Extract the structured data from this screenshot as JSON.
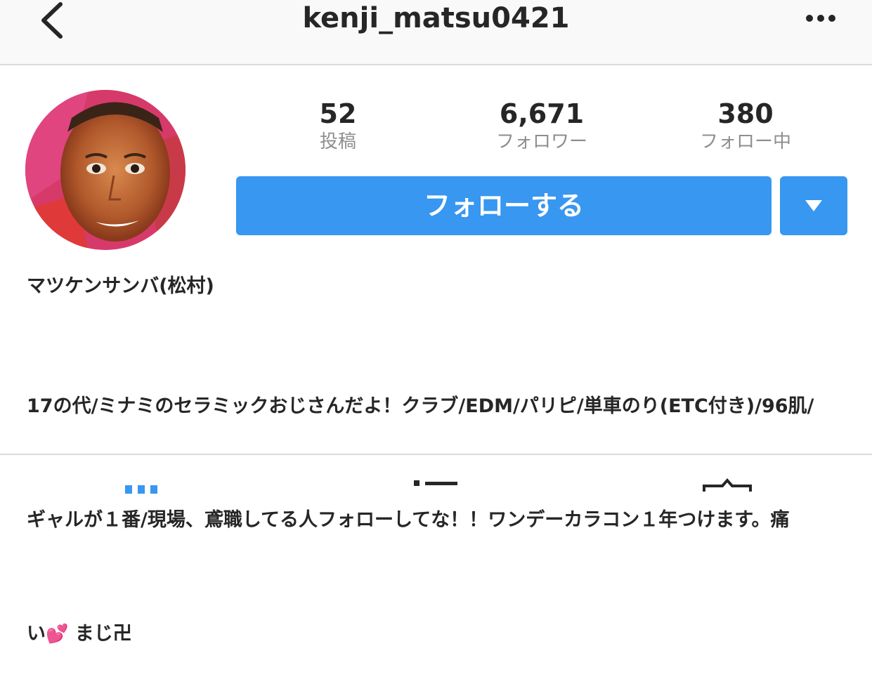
{
  "header": {
    "username": "kenji_matsu0421",
    "back_icon": "chevron-left-icon",
    "more_icon": "more-horizontal-icon"
  },
  "profile": {
    "avatar_icon": "profile-avatar"
  },
  "stats": [
    {
      "value": "52",
      "label": "投稿"
    },
    {
      "value": "6,671",
      "label": "フォロワー"
    },
    {
      "value": "380",
      "label": "フォロー中"
    }
  ],
  "actions": {
    "follow_label": "フォローする",
    "dropdown_icon": "caret-down-icon",
    "accent_color": "#3897f0"
  },
  "bio": {
    "display_name": "マツケンサンバ(松村)",
    "line1": "17の代/ミナミのセラミックおじさんだよ！クラブ/EDM/パリピ/単車のり(ETC付き)/96肌/",
    "line2": "ギャルが１番/現場、鳶職してる人フォローしてな！！ワンデーカラコン１年つけます。痛",
    "line3_pre": "い",
    "line3_emoji": "💕",
    "line3_post": " まじ卍"
  },
  "tabs": [
    {
      "icon": "grid-icon"
    },
    {
      "icon": "list-icon"
    },
    {
      "icon": "tagged-icon"
    }
  ]
}
